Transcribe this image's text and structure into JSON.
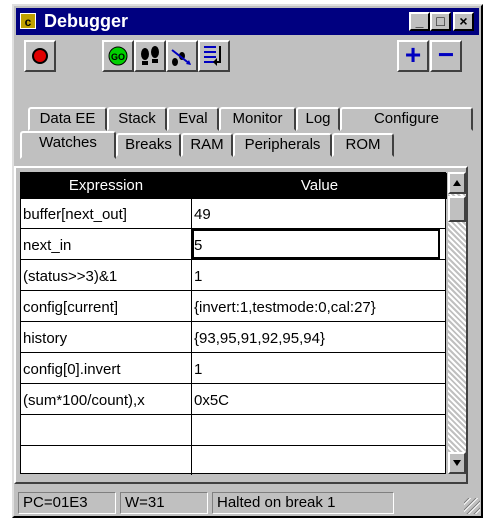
{
  "window": {
    "title": "Debugger",
    "app_icon": "c"
  },
  "title_buttons": {
    "minimize": "_",
    "maximize": "□",
    "close": "×"
  },
  "toolbar": {
    "icons": [
      "record-stop-icon",
      "go-icon",
      "step-icon",
      "step-over-icon",
      "step-out-icon"
    ],
    "go_label": "GO",
    "add_label": "+",
    "remove_label": "−"
  },
  "tabs": {
    "row1": [
      "Data EE",
      "Stack",
      "Eval",
      "Monitor",
      "Log",
      "Configure"
    ],
    "row2": [
      "Watches",
      "Breaks",
      "RAM",
      "Peripherals",
      "ROM"
    ],
    "active": "Watches"
  },
  "grid": {
    "headers": [
      "Expression",
      "Value"
    ],
    "rows": [
      {
        "expr": "buffer[next_out]",
        "value": "49"
      },
      {
        "expr": "next_in",
        "value": "5"
      },
      {
        "expr": "(status>>3)&1",
        "value": "1"
      },
      {
        "expr": "config[current]",
        "value": "{invert:1,testmode:0,cal:27}"
      },
      {
        "expr": "history",
        "value": "{93,95,91,92,95,94}"
      },
      {
        "expr": "config[0].invert",
        "value": "1"
      },
      {
        "expr": "(sum*100/count),x",
        "value": "0x5C"
      },
      {
        "expr": "",
        "value": ""
      }
    ]
  },
  "status": {
    "pc": "PC=01E3",
    "w": "W=31",
    "message": "Halted on break 1"
  },
  "colors": {
    "title_bg": "#000080",
    "face": "#c0c0c0",
    "header_bg": "#000000"
  }
}
